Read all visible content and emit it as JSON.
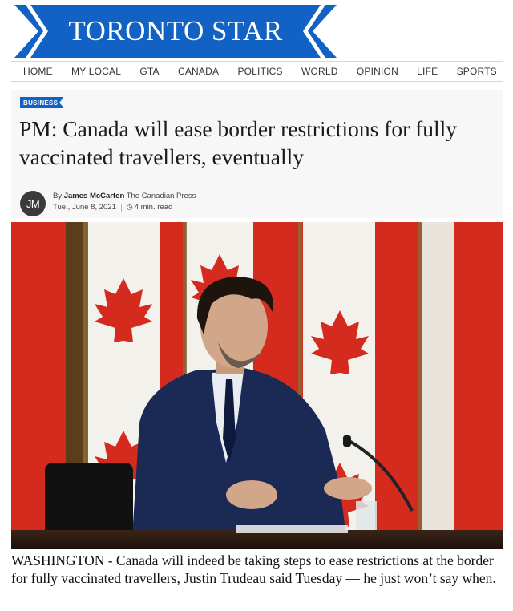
{
  "masthead": {
    "title": "TORONTO STAR"
  },
  "nav": {
    "items": [
      {
        "label": "HOME"
      },
      {
        "label": "MY LOCAL"
      },
      {
        "label": "GTA"
      },
      {
        "label": "CANADA"
      },
      {
        "label": "POLITICS"
      },
      {
        "label": "WORLD"
      },
      {
        "label": "OPINION"
      },
      {
        "label": "LIFE"
      },
      {
        "label": "SPORTS"
      }
    ]
  },
  "article": {
    "section": "BUSINESS",
    "headline": "PM: Canada will ease border restrictions for fully vaccinated travellers, eventually",
    "byline_prefix": "By",
    "author": "James McCarten",
    "outlet": "The Canadian Press",
    "author_initials": "JM",
    "date": "Tue., June 8, 2021",
    "read_time": "4 min. read",
    "lede": "WASHINGTON - Canada will indeed be taking steps to ease restrictions at the border for fully vaccinated travellers, Justin Trudeau said Tuesday — he just won’t say when."
  },
  "colors": {
    "brand_blue": "#1162c4",
    "flag_red": "#d52b1e"
  },
  "icons": {
    "clock": "clock-icon"
  }
}
